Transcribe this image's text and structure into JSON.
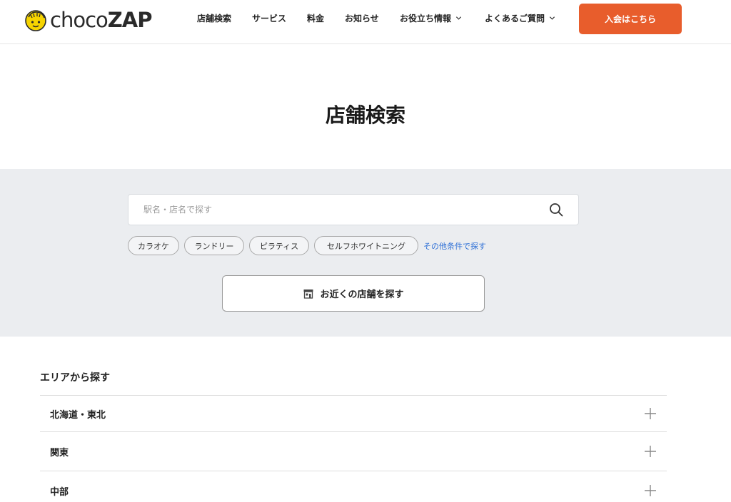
{
  "header": {
    "logo_text_light": "choco",
    "logo_text_bold": "ZAP",
    "logo_icon": "chocozap-mascot-icon",
    "nav": [
      {
        "label": "店舗検索"
      },
      {
        "label": "サービス"
      },
      {
        "label": "料金"
      },
      {
        "label": "お知らせ"
      },
      {
        "label": "お役立ち情報",
        "dropdown": true
      },
      {
        "label": "よくあるご質問",
        "dropdown": true
      }
    ],
    "join_label": "入会はこちら"
  },
  "page": {
    "title": "店舗検索"
  },
  "search": {
    "placeholder": "駅名・店名で探す",
    "value": "",
    "icon": "search-icon",
    "chips": [
      "カラオケ",
      "ランドリー",
      "ピラティス",
      "セルフホワイトニング"
    ],
    "other_link": "その他条件で探す",
    "nearby_label": "お近くの店舗を探す",
    "nearby_icon": "store-icon"
  },
  "area": {
    "heading": "エリアから探す",
    "items": [
      {
        "label": "北海道・東北"
      },
      {
        "label": "関東"
      },
      {
        "label": "中部"
      }
    ],
    "expand_icon": "plus-icon"
  },
  "colors": {
    "accent": "#e85d2c",
    "link": "#2d6fd6",
    "band": "#ebedf0",
    "logo_yellow": "#f6d400"
  }
}
